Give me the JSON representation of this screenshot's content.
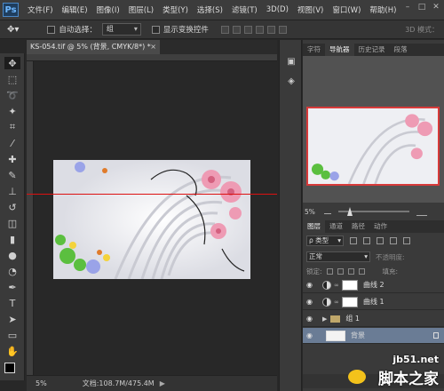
{
  "menubar": {
    "logo": "Ps",
    "items": [
      "文件(F)",
      "编辑(E)",
      "图像(I)",
      "图层(L)",
      "类型(Y)",
      "选择(S)",
      "滤镜(T)",
      "3D(D)",
      "视图(V)",
      "窗口(W)",
      "帮助(H)"
    ]
  },
  "options": {
    "auto_select_label": "自动选择：",
    "auto_select_value": "组",
    "show_transform_label": "显示变换控件",
    "mode_3d_label": "3D 模式："
  },
  "document": {
    "tab_title": "KS-054.tif @ 5% (背景, CMYK/8*) *",
    "zoom": "5%",
    "doc_size": "文档:108.7M/475.4M"
  },
  "navigator": {
    "tabs": [
      "字符",
      "导航器",
      "历史记录",
      "段落"
    ],
    "active_tab": "导航器",
    "zoom": "5%"
  },
  "layers": {
    "tabs": [
      "图层",
      "通道",
      "路径",
      "动作"
    ],
    "filter_kind": "ρ 类型",
    "blend_mode": "正常",
    "opacity_label": "不透明度:",
    "lock_label": "锁定:",
    "fill_label": "填充:",
    "items": [
      {
        "name": "曲线 2",
        "type": "adjustment"
      },
      {
        "name": "曲线 1",
        "type": "adjustment"
      },
      {
        "name": "组 1",
        "type": "group"
      },
      {
        "name": "背景",
        "type": "background"
      }
    ]
  },
  "watermark": {
    "url": "jb51.net",
    "name": "脚本之家"
  }
}
